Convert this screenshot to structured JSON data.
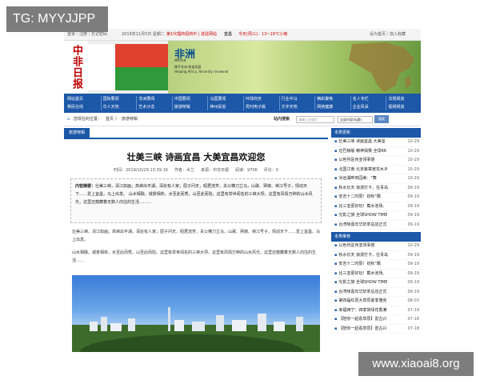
{
  "watermark_tl": "TG: MYYJJPP",
  "watermark_br": "www.xiaoai8.org",
  "topbar": {
    "links": "登录｜注册｜忘记密码",
    "date": "2019年11月5日 星期二",
    "promo": "第1代理商招商中 | 进驻网站",
    "city": "宜昌",
    "weather": "今天(周三)：13~19℃小雨",
    "right": "设为首页｜加入收藏"
  },
  "banner": {
    "logo": "中非日报",
    "title": "非洲",
    "title_en": "Africa",
    "slogan_cn": "携手非洲 和谐发展",
    "slogan_en": "Helping Africa, Recently reviewed"
  },
  "nav": {
    "items": [
      [
        "网站首页",
        "移民在线"
      ],
      [
        "国际要闻",
        "华人天地"
      ],
      [
        "非洲要闻",
        "艺术沙龙"
      ],
      [
        "中国要闻",
        "旅游特辑"
      ],
      [
        "马国要闻",
        "神州民俗"
      ],
      [
        "环球商务",
        "周刊电子版"
      ],
      [
        "行业中马",
        "文字天地"
      ],
      [
        "精彩聚焦",
        "网络健康"
      ],
      [
        "名人专栏",
        "企业风采"
      ],
      [
        "法规频道",
        "视频频道"
      ]
    ]
  },
  "crumb": {
    "location": "您现在的位置：",
    "home": "首页",
    "sep": "〉",
    "section": "旅游特辑",
    "search_label": "站内搜索",
    "search_placeholder": "请输入关键字",
    "select": "全部内容(标题)",
    "go": "搜索"
  },
  "article": {
    "tab": "旅游特辑",
    "title": "壮美三峡 诗画宜昌 大美宜昌欢迎您",
    "time": "时间：2019/10/29 13:39:16",
    "author": "作者：木兰",
    "source": "来源：中非日报",
    "views": "阅读：9706",
    "comments": "评论：0",
    "summary_label": "内容摘要：",
    "summary": "壮美三峡，清江如画；高峡出平湖，深处有人家；屈子问天，昭君流芳，关公横刀立马，山歌、哭嫁、峡江号子，情动天下……爱上宜昌，马上出发。 山水相融，城景相依，水至此而秀，山至此而险。这里有举世闻名的三峡大坝，这里有风情万种的山水风光，这里还蕴藏着无数人向往的生活………",
    "p1": "壮美三峡，清江如画；高峡出平湖，深处有人家；屈子问天，昭君流芳，关公横刀立马，山歌、哭嫁、峡江号子，情动天下……爱上宜昌，马上出发。",
    "p2": "山水相融，城景相依，水至此而秀，山至此而险。这里有举世闻名的三峡大坝，这里有风情万种的山水风光，这里还蕴藏着无数人向往的生活……"
  },
  "sidebar": {
    "latest_title": "本类更新",
    "latest": [
      [
        "壮美三峡 诗画宜昌 大美宜",
        "10-29"
      ],
      [
        "迈巴赫版 精神揭赛 全球66",
        "10-29"
      ],
      [
        "以色列驻肯亚领事馆",
        "10-29"
      ],
      [
        "北国江南 北京紫禁宫花水乡",
        "10-29"
      ],
      [
        "冰远湖畔田园美：\"舞",
        "10-29"
      ],
      [
        "秋水长天 浪漫打卡，在青岛",
        "09-19"
      ],
      [
        "安吉十二时辰！初秋\"隅",
        "09-19"
      ],
      [
        "比三亚更好玩！截水池场、",
        "09-19"
      ],
      [
        "光影之旅 全球SHOW TIME",
        "09-19"
      ],
      [
        "台湾味嘉年华奶茶总店正式",
        "09-19"
      ]
    ],
    "rec_title": "本类推荐",
    "rec": [
      [
        "以色列驻肯亚领事馆",
        "10-29"
      ],
      [
        "秋水长天 浪漫打卡，在青岛",
        "09-19"
      ],
      [
        "安吉十二时辰！初秋\"隅",
        "09-19"
      ],
      [
        "比三亚更好玩！截水池场、",
        "09-19"
      ],
      [
        "光影之旅 全球SHOW TIME",
        "09-19"
      ],
      [
        "台湾味嘉年华奶茶总店正式",
        "09-19"
      ],
      [
        "第四届红原大草原夏季雅克",
        "08-03"
      ],
      [
        "幸福西宁：四季常绿花香满",
        "07-19"
      ],
      [
        "【陪你一起看草原】雷古兴",
        "07-18"
      ],
      [
        "【陪你一起看草原】雷古兴",
        "07-18"
      ]
    ]
  }
}
